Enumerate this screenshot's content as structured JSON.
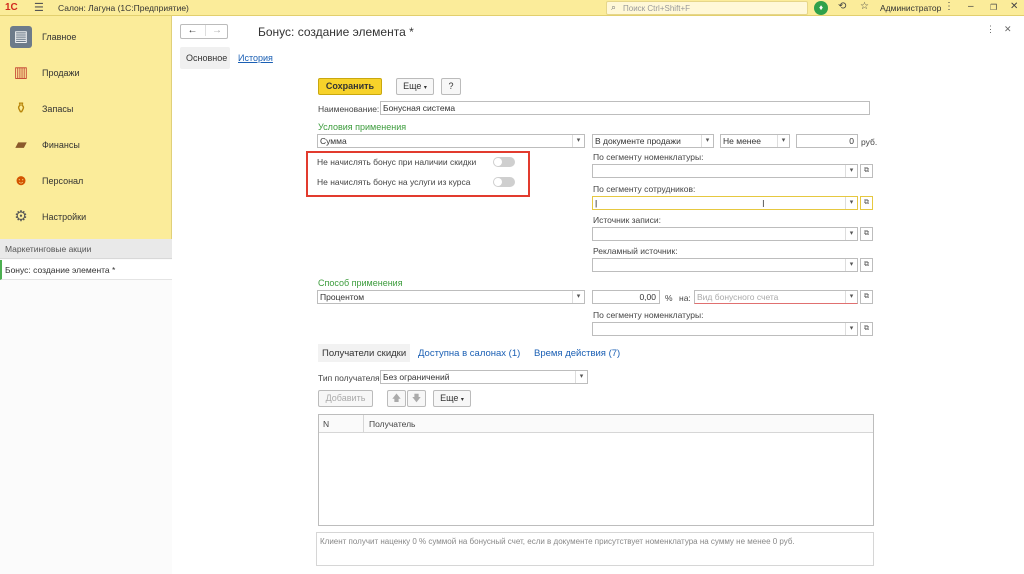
{
  "topbar": {
    "logo": "1С",
    "app_title": "Салон: Лагуна  (1С:Предприятие)",
    "search_placeholder": "Поиск Ctrl+Shift+F",
    "user": "Администратор"
  },
  "sidebar": {
    "items": [
      {
        "label": "Главное"
      },
      {
        "label": "Продажи"
      },
      {
        "label": "Запасы"
      },
      {
        "label": "Финансы"
      },
      {
        "label": "Персонал"
      },
      {
        "label": "Настройки"
      }
    ],
    "open_windows": {
      "header": "Маркетинговые акции",
      "items": [
        {
          "label": "Бонус: создание элемента *"
        }
      ]
    }
  },
  "form": {
    "title": "Бонус: создание элемента *",
    "tabs": {
      "main": "Основное",
      "history": "История"
    },
    "toolbar": {
      "save": "Сохранить",
      "more": "Еще",
      "help": "?"
    },
    "name_label": "Наименование:",
    "name_value": "Бонусная система",
    "conditions_header": "Условия применения",
    "condition_type": "Сумма",
    "condition_doc": "В документе продажи",
    "condition_cmp": "Не менее",
    "condition_amount": "0",
    "currency": "руб.",
    "toggle1_label": "Не начислять бонус при наличии скидки",
    "toggle2_label": "Не начислять бонус на услуги из курса",
    "segment_nom_label": "По сегменту номенклатуры:",
    "segment_emp_label": "По сегменту сотрудников:",
    "source_label": "Источник записи:",
    "ad_source_label": "Рекламный источник:",
    "method_header": "Способ применения",
    "method_type": "Процентом",
    "method_value": "0,00",
    "percent_sign": "%",
    "to_label": "на:",
    "bonus_account_placeholder": "Вид бонусного счета",
    "segment_nom2_label": "По сегменту номенклатуры:"
  },
  "subtabs": {
    "recipients": "Получатели скидки",
    "salons": "Доступна в салонах (1)",
    "period": "Время действия (7)"
  },
  "recipients": {
    "type_label": "Тип получателя:",
    "type_value": "Без ограничений",
    "add_button": "Добавить",
    "more_button": "Еще",
    "columns": {
      "n": "N",
      "recipient": "Получатель"
    }
  },
  "info_text": "Клиент получит наценку 0 % суммой на бонусный счет, если в документе присутствует номенклатура на сумму не менее 0 руб."
}
